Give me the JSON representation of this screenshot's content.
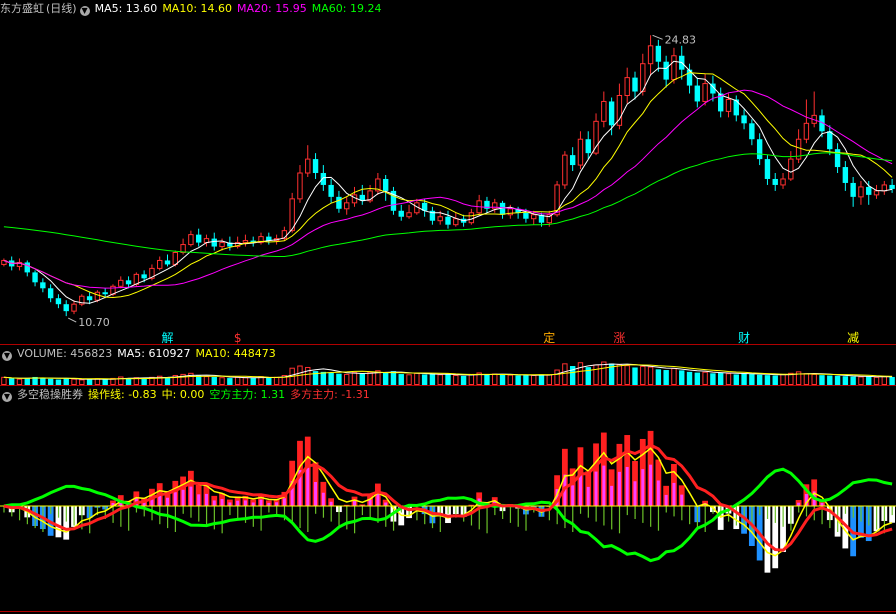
{
  "header": {
    "stock_name": "东方盛虹",
    "period": "(日线)",
    "ma_labels": [
      "MA5: 13.60",
      "MA10: 14.60",
      "MA20: 15.95",
      "MA60: 19.24"
    ],
    "colors": {
      "ma5": "#ffffff",
      "ma10": "#ffff00",
      "ma20": "#ff00ff",
      "ma60": "#00ff00"
    }
  },
  "volume_header": {
    "label": "VOLUME: 456823",
    "ma_labels": [
      "MA5: 610927",
      "MA10: 448473"
    ],
    "colors": {
      "label": "#c0c0c0",
      "ma5": "#ffffff",
      "ma10": "#ffff00"
    }
  },
  "indicator_header": {
    "name": "多空稳操胜券",
    "labels": [
      "操作线: -0.83",
      "中: 0.00",
      "空方主力: 1.31",
      "多方主力: -1.31"
    ],
    "colors": {
      "name": "#c0c0c0",
      "op": "#ffff00",
      "mid": "#ffff00",
      "bear": "#00ff00",
      "bull": "#ff3030"
    }
  },
  "collapse_icon": "chevron-down-icon",
  "chart_data": [
    {
      "type": "candlestick",
      "title": "东方盛虹 (日线)",
      "ylim": [
        9.8,
        25.8
      ],
      "price_labels": {
        "high": "24.83",
        "low": "10.70"
      },
      "events": [
        "解",
        "$",
        "定",
        "涨",
        "财",
        "减"
      ],
      "event_colors": [
        "#00ffff",
        "#ff3030",
        "#ffaa00",
        "#ff3030",
        "#00ffff",
        "#ffff00"
      ],
      "candles": [
        [
          13.3,
          13.5,
          13.6,
          13.2
        ],
        [
          13.5,
          13.2,
          13.7,
          13.0
        ],
        [
          13.2,
          13.4,
          13.6,
          13.0
        ],
        [
          13.4,
          12.9,
          13.5,
          12.7
        ],
        [
          12.9,
          12.4,
          13.0,
          12.2
        ],
        [
          12.4,
          12.1,
          12.6,
          11.9
        ],
        [
          12.1,
          11.6,
          12.3,
          11.4
        ],
        [
          11.6,
          11.3,
          11.8,
          11.1
        ],
        [
          11.3,
          10.95,
          11.5,
          10.7
        ],
        [
          10.95,
          11.3,
          11.5,
          10.8
        ],
        [
          11.3,
          11.7,
          11.8,
          11.2
        ],
        [
          11.7,
          11.5,
          11.9,
          11.3
        ],
        [
          11.5,
          11.9,
          12.0,
          11.4
        ],
        [
          11.9,
          11.8,
          12.1,
          11.6
        ],
        [
          11.8,
          12.2,
          12.3,
          11.7
        ],
        [
          12.2,
          12.5,
          12.7,
          12.1
        ],
        [
          12.5,
          12.3,
          12.7,
          12.1
        ],
        [
          12.3,
          12.8,
          12.9,
          12.2
        ],
        [
          12.8,
          12.6,
          13.0,
          12.4
        ],
        [
          12.6,
          13.1,
          13.3,
          12.5
        ],
        [
          13.1,
          13.5,
          13.7,
          13.0
        ],
        [
          13.5,
          13.3,
          13.8,
          13.2
        ],
        [
          13.3,
          13.9,
          14.0,
          13.2
        ],
        [
          13.9,
          14.3,
          14.6,
          13.8
        ],
        [
          14.3,
          14.8,
          15.0,
          14.2
        ],
        [
          14.8,
          14.4,
          15.1,
          14.2
        ],
        [
          14.4,
          14.6,
          14.8,
          14.2
        ],
        [
          14.6,
          14.2,
          14.9,
          14.0
        ],
        [
          14.2,
          14.4,
          14.6,
          14.0
        ],
        [
          14.4,
          14.2,
          14.7,
          14.0
        ],
        [
          14.2,
          14.4,
          14.7,
          14.1
        ],
        [
          14.4,
          14.5,
          14.8,
          14.2
        ],
        [
          14.5,
          14.4,
          14.7,
          14.2
        ],
        [
          14.4,
          14.7,
          14.9,
          14.3
        ],
        [
          14.7,
          14.5,
          14.9,
          14.3
        ],
        [
          14.5,
          14.6,
          14.8,
          14.3
        ],
        [
          14.6,
          15.0,
          15.2,
          14.5
        ],
        [
          15.0,
          16.6,
          16.9,
          14.9
        ],
        [
          16.6,
          17.9,
          18.3,
          16.4
        ],
        [
          17.9,
          18.6,
          19.3,
          17.7
        ],
        [
          18.6,
          17.9,
          18.9,
          17.6
        ],
        [
          17.9,
          17.3,
          18.3,
          17.0
        ],
        [
          17.3,
          16.7,
          17.6,
          16.4
        ],
        [
          16.7,
          16.1,
          17.0,
          15.9
        ],
        [
          16.1,
          16.4,
          16.7,
          15.8
        ],
        [
          16.4,
          16.8,
          17.2,
          16.2
        ],
        [
          16.8,
          16.5,
          17.3,
          16.3
        ],
        [
          16.5,
          17.0,
          17.3,
          16.4
        ],
        [
          17.0,
          17.6,
          17.9,
          16.8
        ],
        [
          17.6,
          17.0,
          17.8,
          16.5
        ],
        [
          17.0,
          16.0,
          17.2,
          15.8
        ],
        [
          16.0,
          15.7,
          16.3,
          15.5
        ],
        [
          15.7,
          15.9,
          16.3,
          15.6
        ],
        [
          15.9,
          16.4,
          16.6,
          15.8
        ],
        [
          16.4,
          16.0,
          16.6,
          15.7
        ],
        [
          16.0,
          15.5,
          16.2,
          15.3
        ],
        [
          15.5,
          15.7,
          16.0,
          15.3
        ],
        [
          15.7,
          15.3,
          16.0,
          15.1
        ],
        [
          15.3,
          15.6,
          15.9,
          15.2
        ],
        [
          15.6,
          15.4,
          15.8,
          15.2
        ],
        [
          15.4,
          15.9,
          16.1,
          15.3
        ],
        [
          15.9,
          16.5,
          16.8,
          15.8
        ],
        [
          16.5,
          16.1,
          16.7,
          15.9
        ],
        [
          16.1,
          16.4,
          16.6,
          15.9
        ],
        [
          16.4,
          15.8,
          16.5,
          15.6
        ],
        [
          15.8,
          16.1,
          16.3,
          15.6
        ],
        [
          16.1,
          15.9,
          16.2,
          15.6
        ],
        [
          15.9,
          15.6,
          16.1,
          15.4
        ],
        [
          15.6,
          15.8,
          16.0,
          15.3
        ],
        [
          15.8,
          15.4,
          15.9,
          15.2
        ],
        [
          15.4,
          15.8,
          16.0,
          15.2
        ],
        [
          15.8,
          17.3,
          17.5,
          15.7
        ],
        [
          17.3,
          18.8,
          19.0,
          17.1
        ],
        [
          18.8,
          18.3,
          19.2,
          18.0
        ],
        [
          18.3,
          19.6,
          20.0,
          18.1
        ],
        [
          19.6,
          18.9,
          20.0,
          18.6
        ],
        [
          18.9,
          20.5,
          20.9,
          18.8
        ],
        [
          20.5,
          21.5,
          22.0,
          20.2
        ],
        [
          21.5,
          20.3,
          21.7,
          19.8
        ],
        [
          20.3,
          21.8,
          22.4,
          20.1
        ],
        [
          21.8,
          22.7,
          23.2,
          21.4
        ],
        [
          22.7,
          22.0,
          23.0,
          21.6
        ],
        [
          22.0,
          23.4,
          23.9,
          21.8
        ],
        [
          23.4,
          24.3,
          24.83,
          22.8
        ],
        [
          24.3,
          23.5,
          24.6,
          23.0
        ],
        [
          23.5,
          22.6,
          23.8,
          22.2
        ],
        [
          22.6,
          23.8,
          24.2,
          22.4
        ],
        [
          23.8,
          23.1,
          24.3,
          22.6
        ],
        [
          23.1,
          22.3,
          23.4,
          21.9
        ],
        [
          22.3,
          21.5,
          22.7,
          21.2
        ],
        [
          21.5,
          22.4,
          22.9,
          21.3
        ],
        [
          22.4,
          21.9,
          22.8,
          21.5
        ],
        [
          21.9,
          21.0,
          22.2,
          20.7
        ],
        [
          21.0,
          21.6,
          21.9,
          20.7
        ],
        [
          21.6,
          20.8,
          21.8,
          20.5
        ],
        [
          20.8,
          20.4,
          21.1,
          20.1
        ],
        [
          20.4,
          19.6,
          20.6,
          19.3
        ],
        [
          19.6,
          18.6,
          19.9,
          18.3
        ],
        [
          18.6,
          17.6,
          18.8,
          17.3
        ],
        [
          17.6,
          17.3,
          17.9,
          17.0
        ],
        [
          17.3,
          17.6,
          17.9,
          17.1
        ],
        [
          17.6,
          18.6,
          19.0,
          17.5
        ],
        [
          18.6,
          19.6,
          20.1,
          18.4
        ],
        [
          19.6,
          20.4,
          21.6,
          19.4
        ],
        [
          20.4,
          20.8,
          22.0,
          20.2
        ],
        [
          20.8,
          20.0,
          21.1,
          19.7
        ],
        [
          20.0,
          19.1,
          20.3,
          18.8
        ],
        [
          19.1,
          18.2,
          19.4,
          17.9
        ],
        [
          18.2,
          17.4,
          18.5,
          17.0
        ],
        [
          17.4,
          16.7,
          17.7,
          16.2
        ],
        [
          16.7,
          17.2,
          17.5,
          16.3
        ],
        [
          17.2,
          16.8,
          17.5,
          16.3
        ],
        [
          16.8,
          17.0,
          17.3,
          16.6
        ],
        [
          17.0,
          17.3,
          17.5,
          16.8
        ],
        [
          17.3,
          17.1,
          17.6,
          16.9
        ]
      ],
      "ma60_start": 15.2
    },
    {
      "type": "bar",
      "title": "VOLUME",
      "values": [
        2.1,
        1.8,
        1.6,
        1.9,
        2.2,
        2.0,
        1.7,
        1.5,
        1.9,
        1.6,
        1.4,
        1.5,
        1.7,
        1.6,
        1.8,
        2.2,
        1.9,
        2.0,
        1.8,
        2.1,
        2.4,
        2.1,
        2.6,
        2.9,
        3.2,
        2.6,
        2.3,
        2.2,
        2.0,
        1.9,
        2.1,
        2.0,
        1.9,
        2.3,
        2.0,
        2.1,
        2.6,
        4.6,
        5.2,
        4.8,
        3.8,
        3.6,
        3.3,
        3.1,
        2.9,
        3.4,
        3.1,
        3.5,
        3.9,
        3.4,
        3.8,
        3.0,
        2.8,
        3.2,
        2.9,
        3.1,
        2.8,
        2.9,
        2.6,
        2.5,
        2.9,
        3.3,
        2.9,
        3.0,
        2.8,
        2.7,
        2.6,
        2.7,
        2.6,
        2.9,
        2.8,
        4.1,
        5.8,
        5.2,
        6.1,
        4.9,
        5.5,
        6.3,
        5.9,
        5.6,
        5.3,
        4.8,
        5.1,
        4.9,
        4.3,
        4.1,
        4.5,
        4.0,
        3.6,
        3.4,
        3.5,
        3.2,
        3.3,
        3.1,
        2.9,
        3.2,
        3.0,
        2.8,
        2.7,
        2.6,
        2.9,
        3.2,
        3.6,
        3.1,
        2.9,
        2.7,
        2.6,
        2.5,
        2.4,
        2.3,
        2.2,
        2.4,
        2.1,
        2.3,
        2.2
      ],
      "ma5": 610927,
      "ma10": 448473
    },
    {
      "type": "bar",
      "title": "多空稳操胜券",
      "ylim": [
        -3.6,
        3.6
      ],
      "operation_line": -0.83,
      "middle": 0.0,
      "bear_main": 1.31,
      "bull_main": -1.31
    }
  ]
}
